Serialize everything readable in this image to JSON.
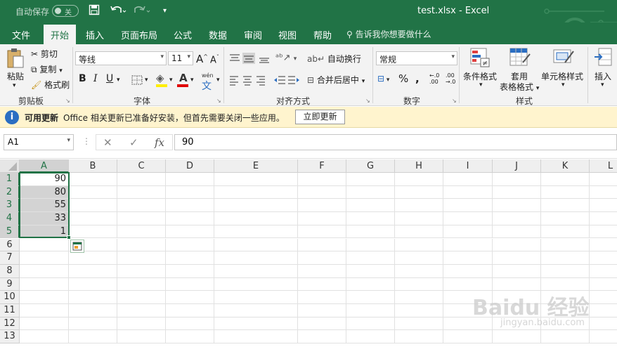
{
  "titlebar": {
    "autosave_label": "自动保存",
    "autosave_state": "关",
    "title": "test.xlsx  -  Excel"
  },
  "tabs": [
    "文件",
    "开始",
    "插入",
    "页面布局",
    "公式",
    "数据",
    "审阅",
    "视图",
    "帮助"
  ],
  "active_tab": "开始",
  "tell_me": "告诉我你想要做什么",
  "ribbon": {
    "clipboard": {
      "paste": "粘贴",
      "cut": "剪切",
      "copy": "复制",
      "format_painter": "格式刷",
      "label": "剪贴板"
    },
    "font": {
      "name": "等线",
      "size": "11",
      "label": "字体",
      "wen": "wén"
    },
    "alignment": {
      "wrap_text": "自动换行",
      "merge_center": "合并后居中",
      "label": "对齐方式"
    },
    "number": {
      "format": "常规",
      "label": "数字"
    },
    "styles": {
      "conditional": "条件格式",
      "table_format_1": "套用",
      "table_format_2": "表格格式",
      "cell_styles": "单元格样式",
      "label": "样式"
    },
    "cells": {
      "insert": "插入"
    }
  },
  "update_bar": {
    "title": "可用更新",
    "message": "Office 相关更新已准备好安装，但首先需要关闭一些应用。",
    "button": "立即更新"
  },
  "formula_bar": {
    "name_box": "A1",
    "value": "90"
  },
  "sheet": {
    "columns": [
      "A",
      "B",
      "C",
      "D",
      "E",
      "F",
      "G",
      "H",
      "I",
      "J",
      "K",
      "L"
    ],
    "rows": [
      "1",
      "2",
      "3",
      "4",
      "5",
      "6",
      "7",
      "8",
      "9",
      "10",
      "11",
      "12",
      "13"
    ],
    "cells_A": [
      "90",
      "80",
      "55",
      "33",
      "1"
    ]
  },
  "watermark": {
    "logo": "Baidu 经验",
    "url": "jingyan.baidu.com"
  }
}
